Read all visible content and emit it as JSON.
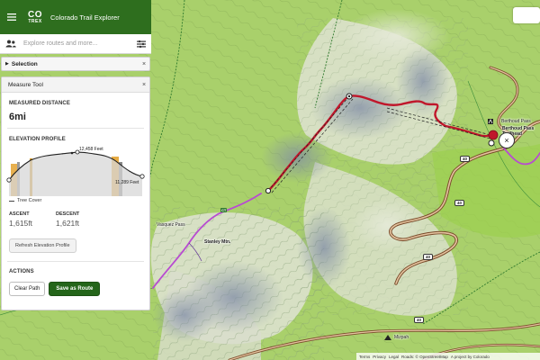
{
  "app": {
    "logo_line1": "CO",
    "logo_line2": "TREX",
    "title": "Colorado Trail Explorer"
  },
  "search": {
    "placeholder": "Explore routes and more..."
  },
  "selection_panel": {
    "label": "Selection",
    "close": "×"
  },
  "measure_tool": {
    "title": "Measure Tool",
    "close": "×",
    "distance_label": "MEASURED DISTANCE",
    "distance_value": "6mi",
    "elevation_label": "ELEVATION PROFILE",
    "max_label": "12,458 Feet",
    "min_label": "11,289 Feet",
    "legend_label": "Tree Cover",
    "ascent_label": "ASCENT",
    "ascent_value": "1,615ft",
    "descent_label": "DESCENT",
    "descent_value": "1,621ft",
    "refresh_button": "Refresh Elevation Profile",
    "actions_label": "ACTIONS",
    "clear_button": "Clear Path",
    "save_button": "Save as Route"
  },
  "map_labels": {
    "berthoud_pass": "Berthoud Pass",
    "berthoud_trailhead_line1": "Berthoud Pass",
    "berthoud_trailhead_line2": "Trailhead",
    "vasquez_pass": "Vasquez Pass",
    "stanley_mtn": "Stanley Mtn.",
    "mizpah": "Mizpah",
    "route_40_a": "40",
    "route_40_b": "40",
    "route_40_c": "40",
    "route_40_d": "40",
    "trail_marker": "CT"
  },
  "close_marker": "×",
  "attribution": {
    "terms": "Terms",
    "privacy": "Privacy",
    "legal": "Legal",
    "roads": "Roads: © OpenStreetMap",
    "project": "A project by Colorado"
  },
  "colors": {
    "header_green": "#2e6e1e",
    "primary_button": "#24651a",
    "measure_line": "#c0172b",
    "trail_magenta": "#b84bd1",
    "map_green": "#a8cf6a",
    "road_orange": "#d2642a"
  }
}
